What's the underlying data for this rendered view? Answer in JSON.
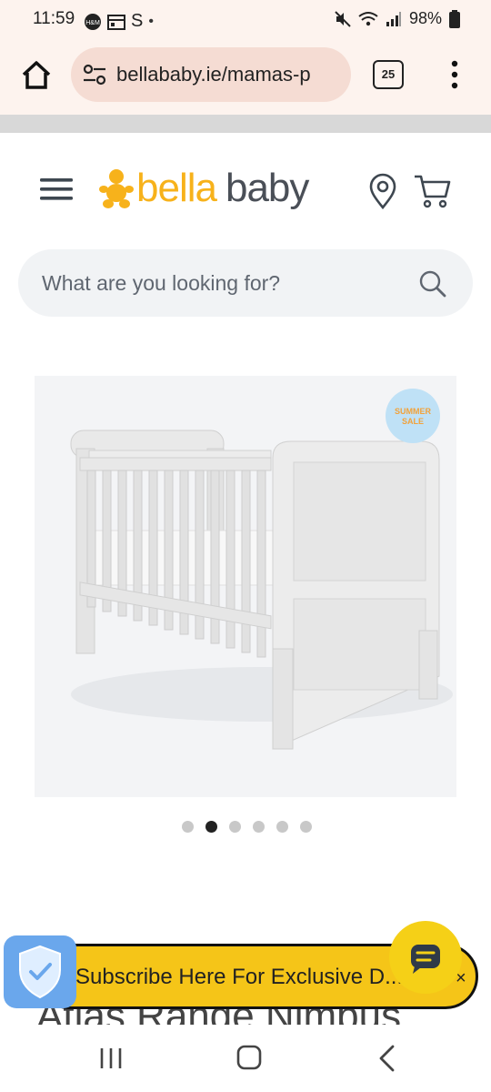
{
  "status_bar": {
    "time": "11:59",
    "carrier_glyph": "S",
    "battery": "98%"
  },
  "browser": {
    "url": "bellababy.ie/mamas-p",
    "tab_count": "25"
  },
  "site": {
    "logo_part1": "bella",
    "logo_part2": "baby",
    "search_placeholder": "What are you looking for?"
  },
  "product": {
    "sale_badge_line1": "SUMMER",
    "sale_badge_line2": "SALE",
    "title_partial": "Atlas Range Nimbus",
    "carousel_total": 6,
    "carousel_active_index": 1
  },
  "banner": {
    "subscribe_text": "Subscribe Here For Exclusive D...",
    "close_label": "×"
  },
  "colors": {
    "brand_yellow": "#f7b21b",
    "brand_grey": "#4a4f57",
    "banner_yellow": "#f5c518",
    "browser_bg": "#fdf3ee",
    "url_bg": "#f5dcd3"
  }
}
